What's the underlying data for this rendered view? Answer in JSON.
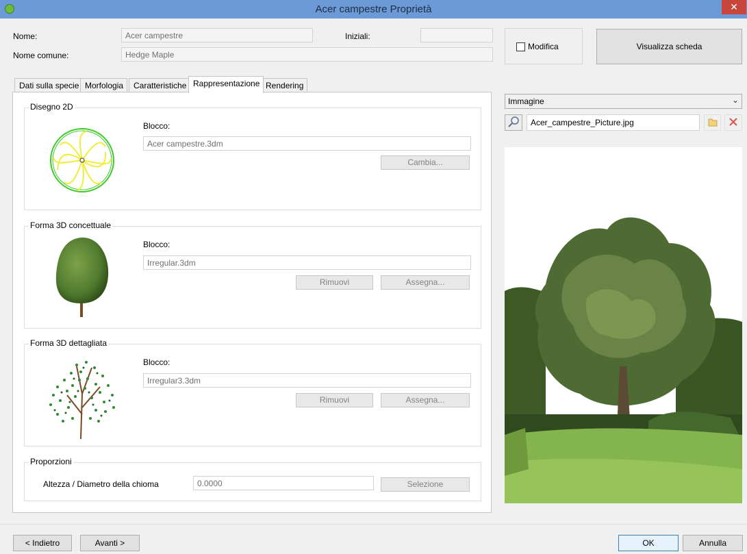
{
  "window": {
    "title": "Acer campestre Proprietà"
  },
  "header": {
    "name_label": "Nome:",
    "name_value": "Acer campestre",
    "common_name_label": "Nome comune:",
    "common_name_value": "Hedge Maple",
    "initials_label": "Iniziali:",
    "initials_value": "",
    "edit_checkbox_label": "Modifica",
    "edit_checked": false,
    "view_sheet_button": "Visualizza scheda"
  },
  "tabs": [
    {
      "label": "Dati sulla specie",
      "active": false
    },
    {
      "label": "Morfologia",
      "active": false
    },
    {
      "label": "Caratteristiche",
      "active": false
    },
    {
      "label": "Rappresentazione",
      "active": true
    },
    {
      "label": "Rendering",
      "active": false
    }
  ],
  "groups": {
    "drawing2d": {
      "title": "Disegno 2D",
      "block_label": "Blocco:",
      "block_value": "Acer campestre.3dm",
      "change_button": "Cambia..."
    },
    "conceptual3d": {
      "title": "Forma 3D concettuale",
      "block_label": "Blocco:",
      "block_value": "Irregular.3dm",
      "remove_button": "Rimuovi",
      "assign_button": "Assegna..."
    },
    "detailed3d": {
      "title": "Forma 3D dettagliata",
      "block_label": "Blocco:",
      "block_value": "Irregular3.3dm",
      "remove_button": "Rimuovi",
      "assign_button": "Assegna..."
    },
    "proportions": {
      "title": "Proporzioni",
      "ratio_label": "Altezza / Diametro della chioma",
      "ratio_value": "0.0000",
      "select_button": "Selezione"
    }
  },
  "image_panel": {
    "type_select": "Immagine",
    "filename": "Acer_campestre_Picture.jpg"
  },
  "footer": {
    "back_button": "< Indietro",
    "next_button": "Avanti >",
    "ok_button": "OK",
    "cancel_button": "Annulla"
  },
  "colors": {
    "titlebar": "#6b9ad7",
    "close": "#c7463b",
    "tree_green": "#4f7a2e",
    "plan_yellow": "#f2ec3a",
    "plan_green": "#3fcb2b"
  }
}
